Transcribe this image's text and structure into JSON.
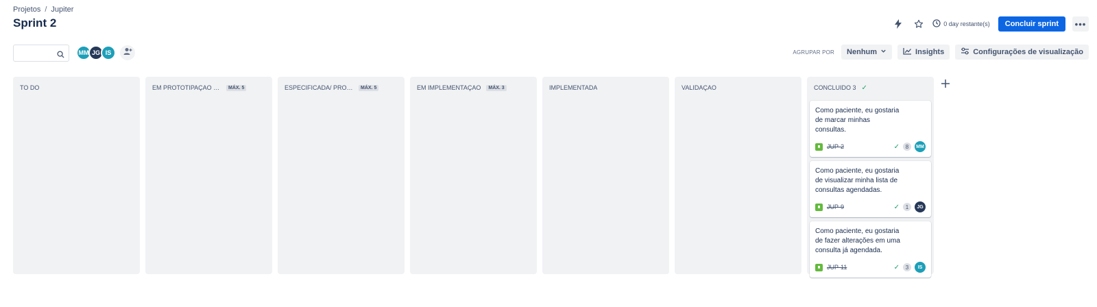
{
  "breadcrumb": {
    "project": "Projetos",
    "separator": "/",
    "name": "Jupiter"
  },
  "page_title": "Sprint 2",
  "header": {
    "remaining": "0 day restante(s)",
    "complete_sprint_label": "Concluir sprint",
    "more_label": "•••"
  },
  "search": {
    "placeholder": "",
    "value": ""
  },
  "people": [
    {
      "initials": "MM",
      "color": "#1d9fb8"
    },
    {
      "initials": "JG",
      "color": "#253858"
    },
    {
      "initials": "IS",
      "color": "#1d9fb8"
    }
  ],
  "toolbar": {
    "group_by_label": "AGRUPAR POR",
    "group_by_value": "Nenhum",
    "insights_label": "Insights",
    "view_settings_label": "Configurações de visualização"
  },
  "columns": [
    {
      "title": "TO DO",
      "wip": ""
    },
    {
      "title": "EM PROTOTIPAÇAO (LO...",
      "wip": "MÁX. 5"
    },
    {
      "title": "ESPECIFICADA/ PROTOT...",
      "wip": "MÁX. 5"
    },
    {
      "title": "EM IMPLEMENTAÇAO",
      "wip": "MÁX. 3"
    },
    {
      "title": "IMPLEMENTADA",
      "wip": ""
    },
    {
      "title": "VALIDAÇAO",
      "wip": ""
    },
    {
      "title": "CONCLUIDO 3",
      "wip": "",
      "done": true
    }
  ],
  "cards": [
    {
      "summary": "Como paciente, eu gostaria de marcar minhas consultas.",
      "key": "JUP-2",
      "points": "8",
      "assignee": "MM",
      "assignee_color": "#1d9fb8"
    },
    {
      "summary": "Como paciente, eu gostaria de visualizar minha lista de consultas agendadas.",
      "key": "JUP-9",
      "points": "1",
      "assignee": "JG",
      "assignee_color": "#253858"
    },
    {
      "summary": "Como paciente, eu gostaria de fazer alterações em uma consulta já agendada.",
      "key": "JUP-11",
      "points": "3",
      "assignee": "IS",
      "assignee_color": "#1d9fb8"
    }
  ]
}
